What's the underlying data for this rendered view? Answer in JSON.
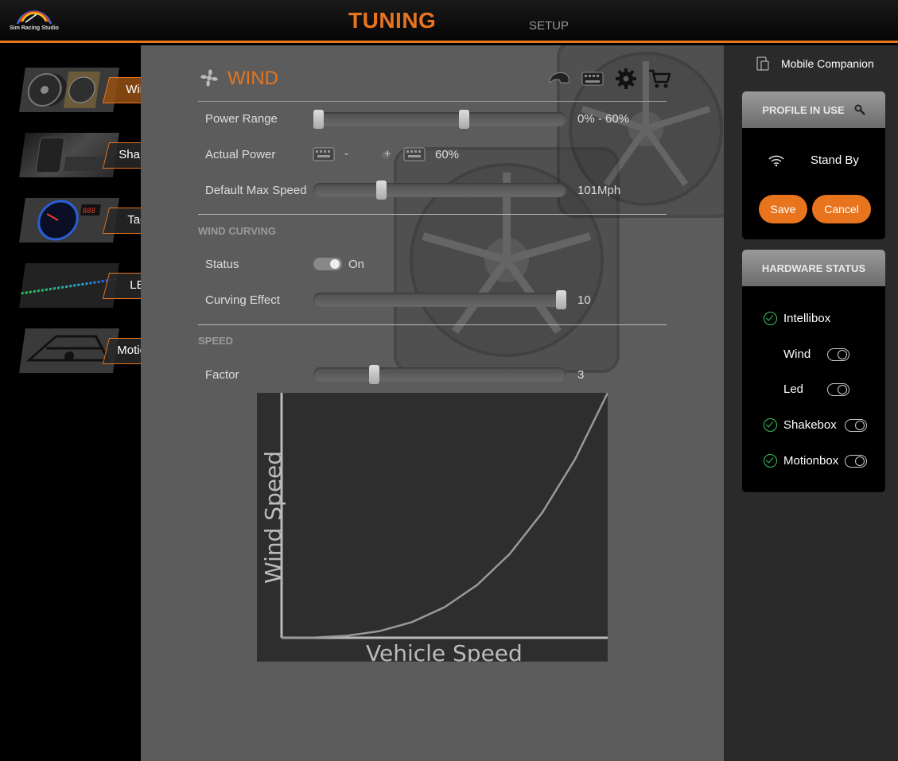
{
  "header": {
    "logo_text": "Sim Racing Studio",
    "tab_tuning": "TUNING",
    "tab_setup": "SETUP"
  },
  "sidebar": {
    "items": [
      {
        "label": "Wind",
        "active": true
      },
      {
        "label": "Shake",
        "active": false
      },
      {
        "label": "Tach",
        "active": false
      },
      {
        "label": "LED",
        "active": false
      },
      {
        "label": "Motion",
        "active": false
      }
    ]
  },
  "main": {
    "title": "WIND",
    "power_range": {
      "label": "Power Range",
      "value": "0% - 60%",
      "low": 0,
      "high": 60
    },
    "actual_power": {
      "label": "Actual Power",
      "minus": "-",
      "plus": "+",
      "value": "60%"
    },
    "default_max_speed": {
      "label": "Default Max Speed",
      "value": "101Mph",
      "level": 0.26
    },
    "wind_curving": {
      "section": "WIND CURVING",
      "status_label": "Status",
      "status_value": "On",
      "curving_label": "Curving Effect",
      "curving_value": "10",
      "level": 1.0
    },
    "speed": {
      "section": "SPEED",
      "factor_label": "Factor",
      "factor_value": "3",
      "level": 0.23
    },
    "chart": {
      "xlabel": "Vehicle Speed",
      "ylabel": "Wind Speed"
    }
  },
  "right": {
    "mobile_companion": "Mobile Companion",
    "profile": {
      "title": "PROFILE IN USE",
      "status": "Stand By",
      "save": "Save",
      "cancel": "Cancel"
    },
    "hardware": {
      "title": "HARDWARE STATUS",
      "items": [
        {
          "label": "Intellibox"
        },
        {
          "label": "Wind"
        },
        {
          "label": "Led"
        },
        {
          "label": "Shakebox"
        },
        {
          "label": "Motionbox"
        }
      ]
    }
  },
  "colors": {
    "accent": "#e8741e",
    "ok": "#3cc45a"
  },
  "chart_data": {
    "type": "line",
    "title": "",
    "xlabel": "Vehicle Speed",
    "ylabel": "Wind Speed",
    "series": [
      {
        "x": [
          0,
          0.1,
          0.2,
          0.3,
          0.4,
          0.5,
          0.6,
          0.7,
          0.8,
          0.9,
          1.0
        ],
        "values": [
          0,
          0.001,
          0.008,
          0.027,
          0.064,
          0.125,
          0.216,
          0.343,
          0.512,
          0.729,
          1.0
        ]
      }
    ],
    "grid": false
  }
}
